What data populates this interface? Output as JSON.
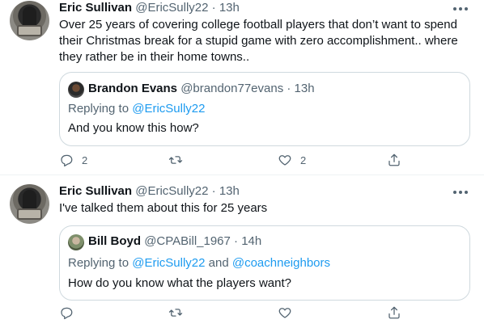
{
  "tweets": [
    {
      "author_name": "Eric Sullivan",
      "author_handle": "@EricSully22",
      "separator": "·",
      "time": "13h",
      "text": "Over 25 years of covering college football players that don’t want to spend their Christmas break for a stupid game with zero accomplishment.. where they rather be in their home towns..",
      "quote": {
        "author_name": "Brandon Evans",
        "author_handle": "@brandon77evans",
        "separator": "·",
        "time": "13h",
        "replying_prefix": "Replying to",
        "replying_to": "@EricSully22",
        "replying_joiner": "",
        "replying_to_2": "",
        "text": "And you know this how?"
      },
      "actions": {
        "reply_count": "2",
        "retweet_count": "",
        "like_count": "2"
      }
    },
    {
      "author_name": "Eric Sullivan",
      "author_handle": "@EricSully22",
      "separator": "·",
      "time": "13h",
      "text": "I've talked them about this for 25 years",
      "quote": {
        "author_name": "Bill Boyd",
        "author_handle": "@CPABill_1967",
        "separator": "·",
        "time": "14h",
        "replying_prefix": "Replying to",
        "replying_to": "@EricSully22",
        "replying_joiner": "and",
        "replying_to_2": "@coachneighbors",
        "text": "How do you know what the players want?"
      },
      "actions": {
        "reply_count": "",
        "retweet_count": "",
        "like_count": ""
      }
    }
  ],
  "icons": {
    "more": "more-icon",
    "reply": "reply-icon",
    "retweet": "retweet-icon",
    "like": "like-icon",
    "share": "share-icon"
  },
  "colors": {
    "text": "#0f1419",
    "secondary": "#536471",
    "link": "#1d9bf0",
    "border": "#cfd9de",
    "divider": "#eff3f4"
  }
}
